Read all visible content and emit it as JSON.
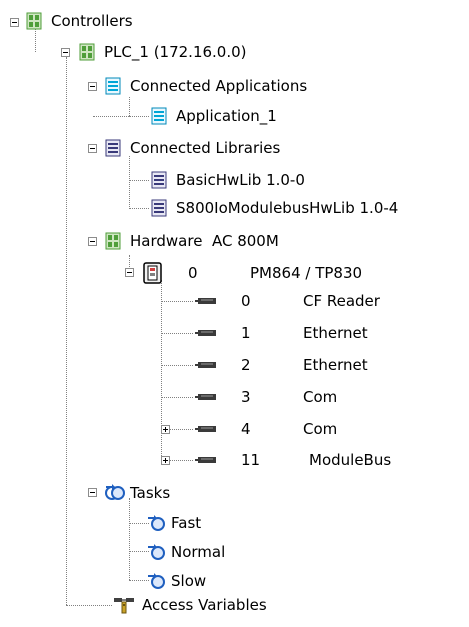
{
  "tree": {
    "root": {
      "label": "Controllers",
      "icon": "controller-rack-icon"
    },
    "plc": {
      "label": "PLC_1 (172.16.0.0)",
      "icon": "controller-rack-icon"
    },
    "connected_apps": {
      "label": "Connected Applications",
      "icon": "application-doc-icon"
    },
    "application_1": {
      "label": "Application_1",
      "icon": "application-doc-icon"
    },
    "connected_libs": {
      "label": "Connected Libraries",
      "icon": "library-doc-icon"
    },
    "lib_basic": {
      "label": "BasicHwLib 1.0-0",
      "icon": "library-doc-icon"
    },
    "lib_s800": {
      "label": "S800IoModulebusHwLib 1.0-4",
      "icon": "library-doc-icon"
    },
    "hardware": {
      "label": "Hardware  AC 800M",
      "icon": "controller-rack-icon"
    },
    "cpu": {
      "position": "0",
      "name": "PM864 / TP830",
      "icon": "cpu-module-icon"
    },
    "units": [
      {
        "position": "0",
        "name": "CF Reader",
        "icon": "port-connector-icon",
        "expandable": false
      },
      {
        "position": "1",
        "name": "Ethernet",
        "icon": "port-connector-icon",
        "expandable": false
      },
      {
        "position": "2",
        "name": "Ethernet",
        "icon": "port-connector-icon",
        "expandable": false
      },
      {
        "position": "3",
        "name": "Com",
        "icon": "port-connector-icon",
        "expandable": false
      },
      {
        "position": "4",
        "name": "Com",
        "icon": "port-connector-icon",
        "expandable": true
      },
      {
        "position": "11",
        "name": "ModuleBus",
        "icon": "port-connector-icon",
        "expandable": true
      }
    ],
    "tasks": {
      "label": "Tasks",
      "icon": "tasks-icon"
    },
    "task_items": [
      {
        "label": "Fast",
        "icon": "task-icon"
      },
      {
        "label": "Normal",
        "icon": "task-icon"
      },
      {
        "label": "Slow",
        "icon": "task-icon"
      }
    ],
    "access_vars": {
      "label": "Access Variables",
      "icon": "access-variables-icon"
    }
  },
  "colors": {
    "rack_green": "#4f9e3a",
    "app_cyan": "#00a6d6",
    "lib_navy": "#3a3a7a",
    "task_blue": "#1f5fbf",
    "tree_line": "#808080"
  }
}
